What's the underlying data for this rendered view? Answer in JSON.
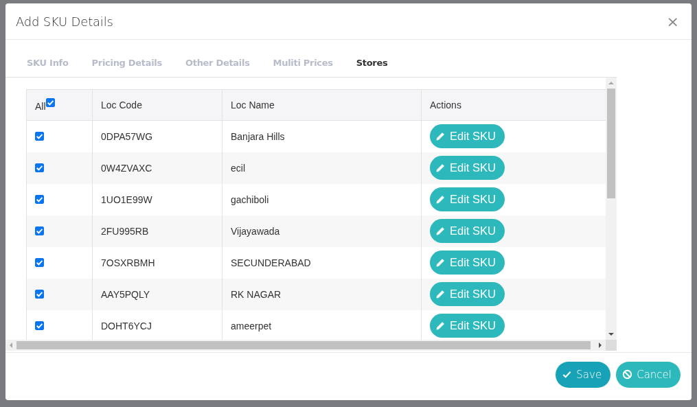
{
  "dialog": {
    "title": "Add SKU Details",
    "close": "×"
  },
  "tabs": [
    {
      "label": "SKU Info",
      "selected": false
    },
    {
      "label": "Pricing Details",
      "selected": false
    },
    {
      "label": "Other Details",
      "selected": false
    },
    {
      "label": "Muliti Prices",
      "selected": false
    },
    {
      "label": "Stores",
      "selected": true
    }
  ],
  "table": {
    "select_all": {
      "label": "All",
      "checked": true
    },
    "columns": [
      "Loc Code",
      "Loc Name",
      "Actions"
    ],
    "rows": [
      {
        "checked": true,
        "loc_code": "0DPA57WG",
        "loc_name": "Banjara Hills",
        "action": "Edit SKU"
      },
      {
        "checked": true,
        "loc_code": "0W4ZVAXC",
        "loc_name": "ecil",
        "action": "Edit SKU"
      },
      {
        "checked": true,
        "loc_code": "1UO1E99W",
        "loc_name": "gachiboli",
        "action": "Edit SKU"
      },
      {
        "checked": true,
        "loc_code": "2FU995RB",
        "loc_name": "Vijayawada",
        "action": "Edit SKU"
      },
      {
        "checked": true,
        "loc_code": "7OSXRBMH",
        "loc_name": "SECUNDERABAD",
        "action": "Edit SKU"
      },
      {
        "checked": true,
        "loc_code": "AAY5PQLY",
        "loc_name": "RK NAGAR",
        "action": "Edit SKU"
      },
      {
        "checked": true,
        "loc_code": "DOHT6YCJ",
        "loc_name": "ameerpet",
        "action": "Edit SKU"
      }
    ]
  },
  "footer": {
    "buttons": [
      {
        "label": "Save",
        "kind": "save"
      },
      {
        "label": "Cancel",
        "kind": "cancel"
      }
    ]
  }
}
